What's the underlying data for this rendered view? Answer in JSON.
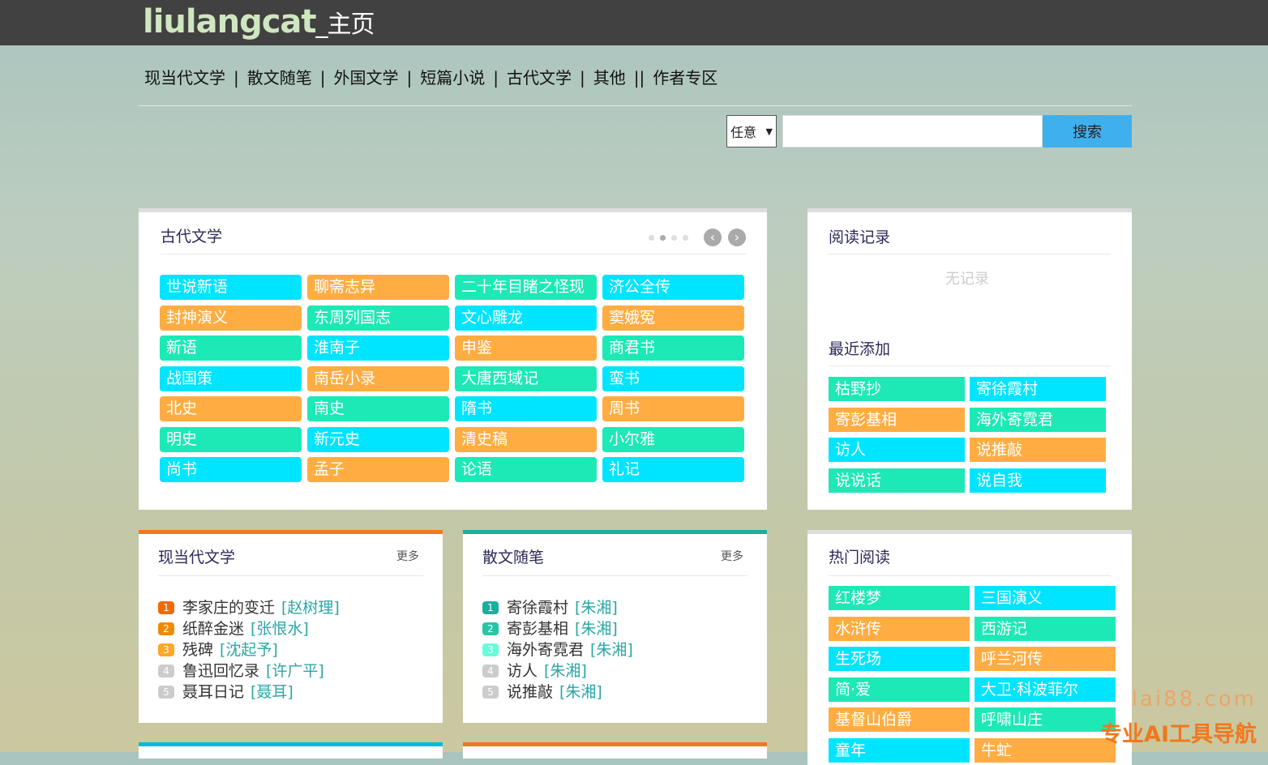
{
  "header": {
    "brand": "liulangcat",
    "brand_sub": "_主页"
  },
  "nav": {
    "items": [
      "现当代文学",
      "散文随笔",
      "外国文学",
      "短篇小说",
      "古代文学",
      "其他"
    ],
    "separator": "|",
    "double_separator": "||",
    "last": "作者专区"
  },
  "search": {
    "select_value": "任意",
    "button_label": "搜索",
    "input_value": ""
  },
  "ancient": {
    "title": "古代文学",
    "tags": [
      {
        "label": "世说新语",
        "color": "cyan"
      },
      {
        "label": "聊斋志异",
        "color": "orange"
      },
      {
        "label": "二十年目睹之怪现",
        "color": "green"
      },
      {
        "label": "济公全传",
        "color": "cyan"
      },
      {
        "label": "封神演义",
        "color": "orange"
      },
      {
        "label": "东周列国志",
        "color": "green"
      },
      {
        "label": "文心雕龙",
        "color": "cyan"
      },
      {
        "label": "窦娥冤",
        "color": "orange"
      },
      {
        "label": "新语",
        "color": "green"
      },
      {
        "label": "淮南子",
        "color": "cyan"
      },
      {
        "label": "申鉴",
        "color": "orange"
      },
      {
        "label": "商君书",
        "color": "green"
      },
      {
        "label": "战国策",
        "color": "cyan"
      },
      {
        "label": "南岳小录",
        "color": "orange"
      },
      {
        "label": "大唐西域记",
        "color": "green"
      },
      {
        "label": "蛮书",
        "color": "cyan"
      },
      {
        "label": "北史",
        "color": "orange"
      },
      {
        "label": "南史",
        "color": "green"
      },
      {
        "label": "隋书",
        "color": "cyan"
      },
      {
        "label": "周书",
        "color": "orange"
      },
      {
        "label": "明史",
        "color": "green"
      },
      {
        "label": "新元史",
        "color": "cyan"
      },
      {
        "label": "清史稿",
        "color": "orange"
      },
      {
        "label": "小尔雅",
        "color": "green"
      },
      {
        "label": "尚书",
        "color": "cyan"
      },
      {
        "label": "孟子",
        "color": "orange"
      },
      {
        "label": "论语",
        "color": "green"
      },
      {
        "label": "礼记",
        "color": "cyan"
      }
    ],
    "prev": "‹",
    "next": "›"
  },
  "history": {
    "title": "阅读记录",
    "empty": "无记录"
  },
  "recent": {
    "title": "最近添加",
    "tags": [
      {
        "label": "枯野抄",
        "color": "green"
      },
      {
        "label": "寄徐霞村",
        "color": "cyan"
      },
      {
        "label": "寄彭基相",
        "color": "orange"
      },
      {
        "label": "海外寄霓君",
        "color": "green"
      },
      {
        "label": "访人",
        "color": "cyan"
      },
      {
        "label": "说推敲",
        "color": "orange"
      },
      {
        "label": "说说话",
        "color": "green"
      },
      {
        "label": "说自我",
        "color": "cyan"
      }
    ]
  },
  "modern": {
    "title": "现当代文学",
    "more": "更多",
    "items": [
      {
        "n": "1",
        "title": "李家庄的变迁",
        "author": "[赵树理]"
      },
      {
        "n": "2",
        "title": "纸醉金迷",
        "author": "[张恨水]"
      },
      {
        "n": "3",
        "title": "残碑",
        "author": "[沈起予]"
      },
      {
        "n": "4",
        "title": "鲁迅回忆录",
        "author": "[许广平]"
      },
      {
        "n": "5",
        "title": "聂耳日记",
        "author": "[聂耳]"
      }
    ]
  },
  "essay": {
    "title": "散文随笔",
    "more": "更多",
    "items": [
      {
        "n": "1",
        "title": "寄徐霞村",
        "author": "[朱湘]"
      },
      {
        "n": "2",
        "title": "寄彭基相",
        "author": "[朱湘]"
      },
      {
        "n": "3",
        "title": "海外寄霓君",
        "author": "[朱湘]"
      },
      {
        "n": "4",
        "title": "访人",
        "author": "[朱湘]"
      },
      {
        "n": "5",
        "title": "说推敲",
        "author": "[朱湘]"
      }
    ]
  },
  "hot": {
    "title": "热门阅读",
    "tags": [
      {
        "label": "红楼梦",
        "color": "green"
      },
      {
        "label": "三国演义",
        "color": "cyan"
      },
      {
        "label": "水浒传",
        "color": "orange"
      },
      {
        "label": "西游记",
        "color": "green"
      },
      {
        "label": "生死场",
        "color": "cyan"
      },
      {
        "label": "呼兰河传",
        "color": "orange"
      },
      {
        "label": "简·爱",
        "color": "green"
      },
      {
        "label": "大卫·科波菲尔",
        "color": "cyan"
      },
      {
        "label": "基督山伯爵",
        "color": "orange"
      },
      {
        "label": "呼啸山庄",
        "color": "green"
      },
      {
        "label": "童年",
        "color": "cyan"
      },
      {
        "label": "牛虻",
        "color": "orange"
      }
    ]
  },
  "watermark": {
    "line1": "lai88.com",
    "line2": "专业AI工具导航"
  },
  "colors": {
    "cyan": "#00e5ff",
    "orange": "#ffad42",
    "green": "#1de9b6",
    "modern_accent": "#f0781e",
    "essay_accent": "#1aae9f",
    "modern_nums": [
      "#f06a00",
      "#f08a00",
      "#ffa726",
      "#cccccc",
      "#cccccc"
    ],
    "essay_nums": [
      "#1aae9f",
      "#26c6a6",
      "#64ffda",
      "#cccccc",
      "#cccccc"
    ]
  }
}
